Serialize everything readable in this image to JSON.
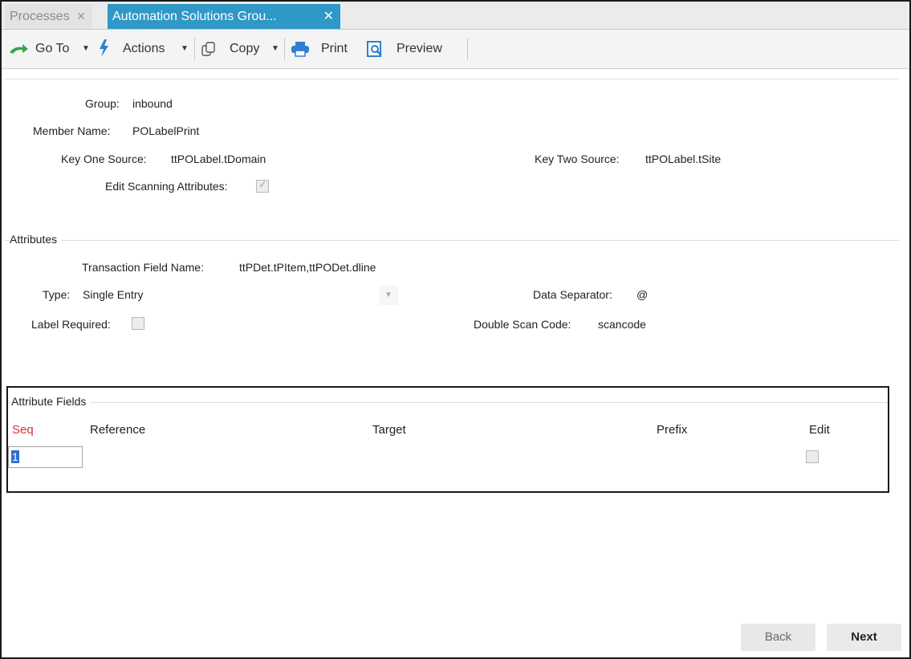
{
  "tabs": {
    "inactive": "Processes",
    "active": "Automation Solutions Grou..."
  },
  "toolbar": {
    "goto": "Go To",
    "actions": "Actions",
    "copy": "Copy",
    "print": "Print",
    "preview": "Preview"
  },
  "header": {
    "group_label": "Group:",
    "group_value": "inbound",
    "member_label": "Member Name:",
    "member_value": "POLabelPrint",
    "key_one_label": "Key One Source:",
    "key_one_value": "ttPOLabel.tDomain",
    "key_two_label": "Key Two Source:",
    "key_two_value": "ttPOLabel.tSite",
    "edit_scan_label": "Edit Scanning Attributes:",
    "edit_scan_checked": true
  },
  "attributes": {
    "section_title": "Attributes",
    "txn_field_label": "Transaction Field Name:",
    "txn_field_value": "ttPDet.tPItem,ttPODet.dline",
    "type_label": "Type:",
    "type_value": "Single Entry",
    "data_sep_label": "Data Separator:",
    "data_sep_value": "@",
    "label_required_label": "Label Required:",
    "label_required_checked": false,
    "double_scan_label": "Double Scan Code:",
    "double_scan_value": "scancode"
  },
  "attribute_fields": {
    "section_title": "Attribute Fields",
    "columns": [
      "Seq",
      "Reference",
      "Target",
      "Prefix",
      "Edit"
    ],
    "rows": [
      {
        "seq": "1",
        "reference": "",
        "target": "",
        "prefix": "",
        "edit": false
      }
    ]
  },
  "buttons": {
    "back": "Back",
    "next": "Next"
  },
  "colors": {
    "active_tab": "#2f98c6",
    "seq_header": "#e03030",
    "selection": "#2f6fd1"
  }
}
